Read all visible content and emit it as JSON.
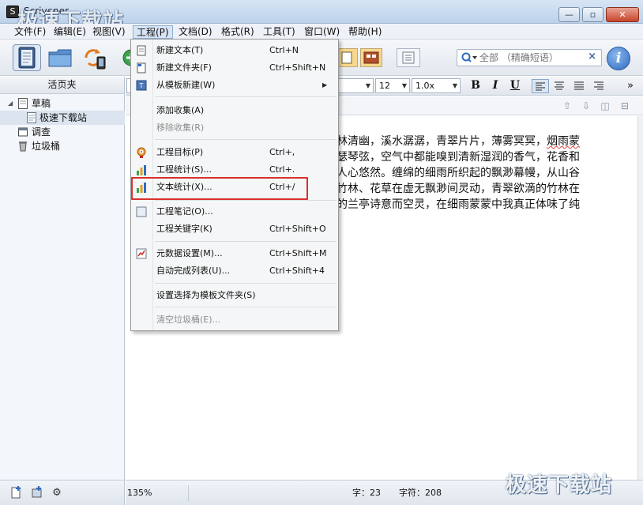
{
  "window": {
    "title": "Scrivener",
    "icon_glyph": "S",
    "min_glyph": "—",
    "max_glyph": "▫",
    "close_glyph": "✕"
  },
  "watermark": {
    "top": "极速下载站",
    "bottom": "极速下载站"
  },
  "menubar": [
    "文件(F)",
    "编辑(E)",
    "视图(V)",
    "工程(P)",
    "文档(D)",
    "格式(R)",
    "工具(T)",
    "窗口(W)",
    "帮助(H)"
  ],
  "toolbar": {
    "search_placeholder": "全部 （精确短语）",
    "search_clear": "×",
    "inspector_glyph": "i"
  },
  "binder": {
    "header": "活页夹",
    "items": [
      {
        "label": "草稿"
      },
      {
        "label": "极速下载站"
      },
      {
        "label": "调查"
      },
      {
        "label": "垃圾桶"
      }
    ]
  },
  "formatbar": {
    "font_size": "12",
    "line_spacing": "1.0x",
    "bold": "B",
    "italic": "I",
    "underline": "U",
    "more": "»"
  },
  "editor": {
    "lines": [
      [
        "林清幽，溪水潺潺，青翠片片，薄雾冥冥，",
        "烟雨蒙"
      ],
      [
        "瑟琴弦，空气中都能嗅到清新湿润的香气，花香和"
      ],
      [
        "人心悠然。缠绵的细雨所织起的飘渺幕幔，从山谷"
      ],
      [
        "竹林、花草在虚无飘渺间灵动，青翠欲滴的竹林在"
      ],
      [
        "的兰亭诗意而空灵，在细雨蒙蒙中我真正体味了纯"
      ]
    ]
  },
  "statusbar": {
    "zoom": "135%",
    "word_count": "字：23",
    "char_count": "字符：208"
  },
  "dropdown": {
    "items": [
      {
        "label": "新建文本(T)",
        "shortcut": "Ctrl+N",
        "icon": "new-text-icon",
        "disabled": false
      },
      {
        "label": "新建文件夹(F)",
        "shortcut": "Ctrl+Shift+N",
        "icon": "new-folder-icon",
        "disabled": false
      },
      {
        "label": "从模板新建(W)",
        "shortcut": "",
        "icon": "template-icon",
        "disabled": false,
        "submenu": true
      },
      {
        "label": "添加收集(A)",
        "shortcut": "",
        "icon": "",
        "disabled": false
      },
      {
        "label": "移除收集(R)",
        "shortcut": "",
        "icon": "",
        "disabled": true
      },
      {
        "label": "工程目标(P)",
        "shortcut": "Ctrl+,",
        "icon": "target-icon",
        "disabled": false
      },
      {
        "label": "工程统计(S)...",
        "shortcut": "Ctrl+.",
        "icon": "bar-chart-icon",
        "disabled": false
      },
      {
        "label": "文本统计(X)...",
        "shortcut": "Ctrl+/",
        "icon": "bar-chart-icon",
        "disabled": false,
        "highlighted": true
      },
      {
        "label": "工程笔记(O)...",
        "shortcut": "",
        "icon": "notes-icon",
        "disabled": false
      },
      {
        "label": "工程关键字(K)",
        "shortcut": "Ctrl+Shift+O",
        "icon": "",
        "disabled": false
      },
      {
        "label": "元数据设置(M)...",
        "shortcut": "Ctrl+Shift+M",
        "icon": "metadata-icon",
        "disabled": false
      },
      {
        "label": "自动完成列表(U)...",
        "shortcut": "Ctrl+Shift+4",
        "icon": "",
        "disabled": false
      },
      {
        "label": "设置选择为模板文件夹(S)",
        "shortcut": "",
        "icon": "",
        "disabled": false
      },
      {
        "label": "清空垃圾桶(E)...",
        "shortcut": "",
        "icon": "",
        "disabled": true
      }
    ]
  },
  "colors": {
    "highlight_border": "#d9302c",
    "accent": "#2f6bc1",
    "layout_button": "#f7d88c"
  }
}
